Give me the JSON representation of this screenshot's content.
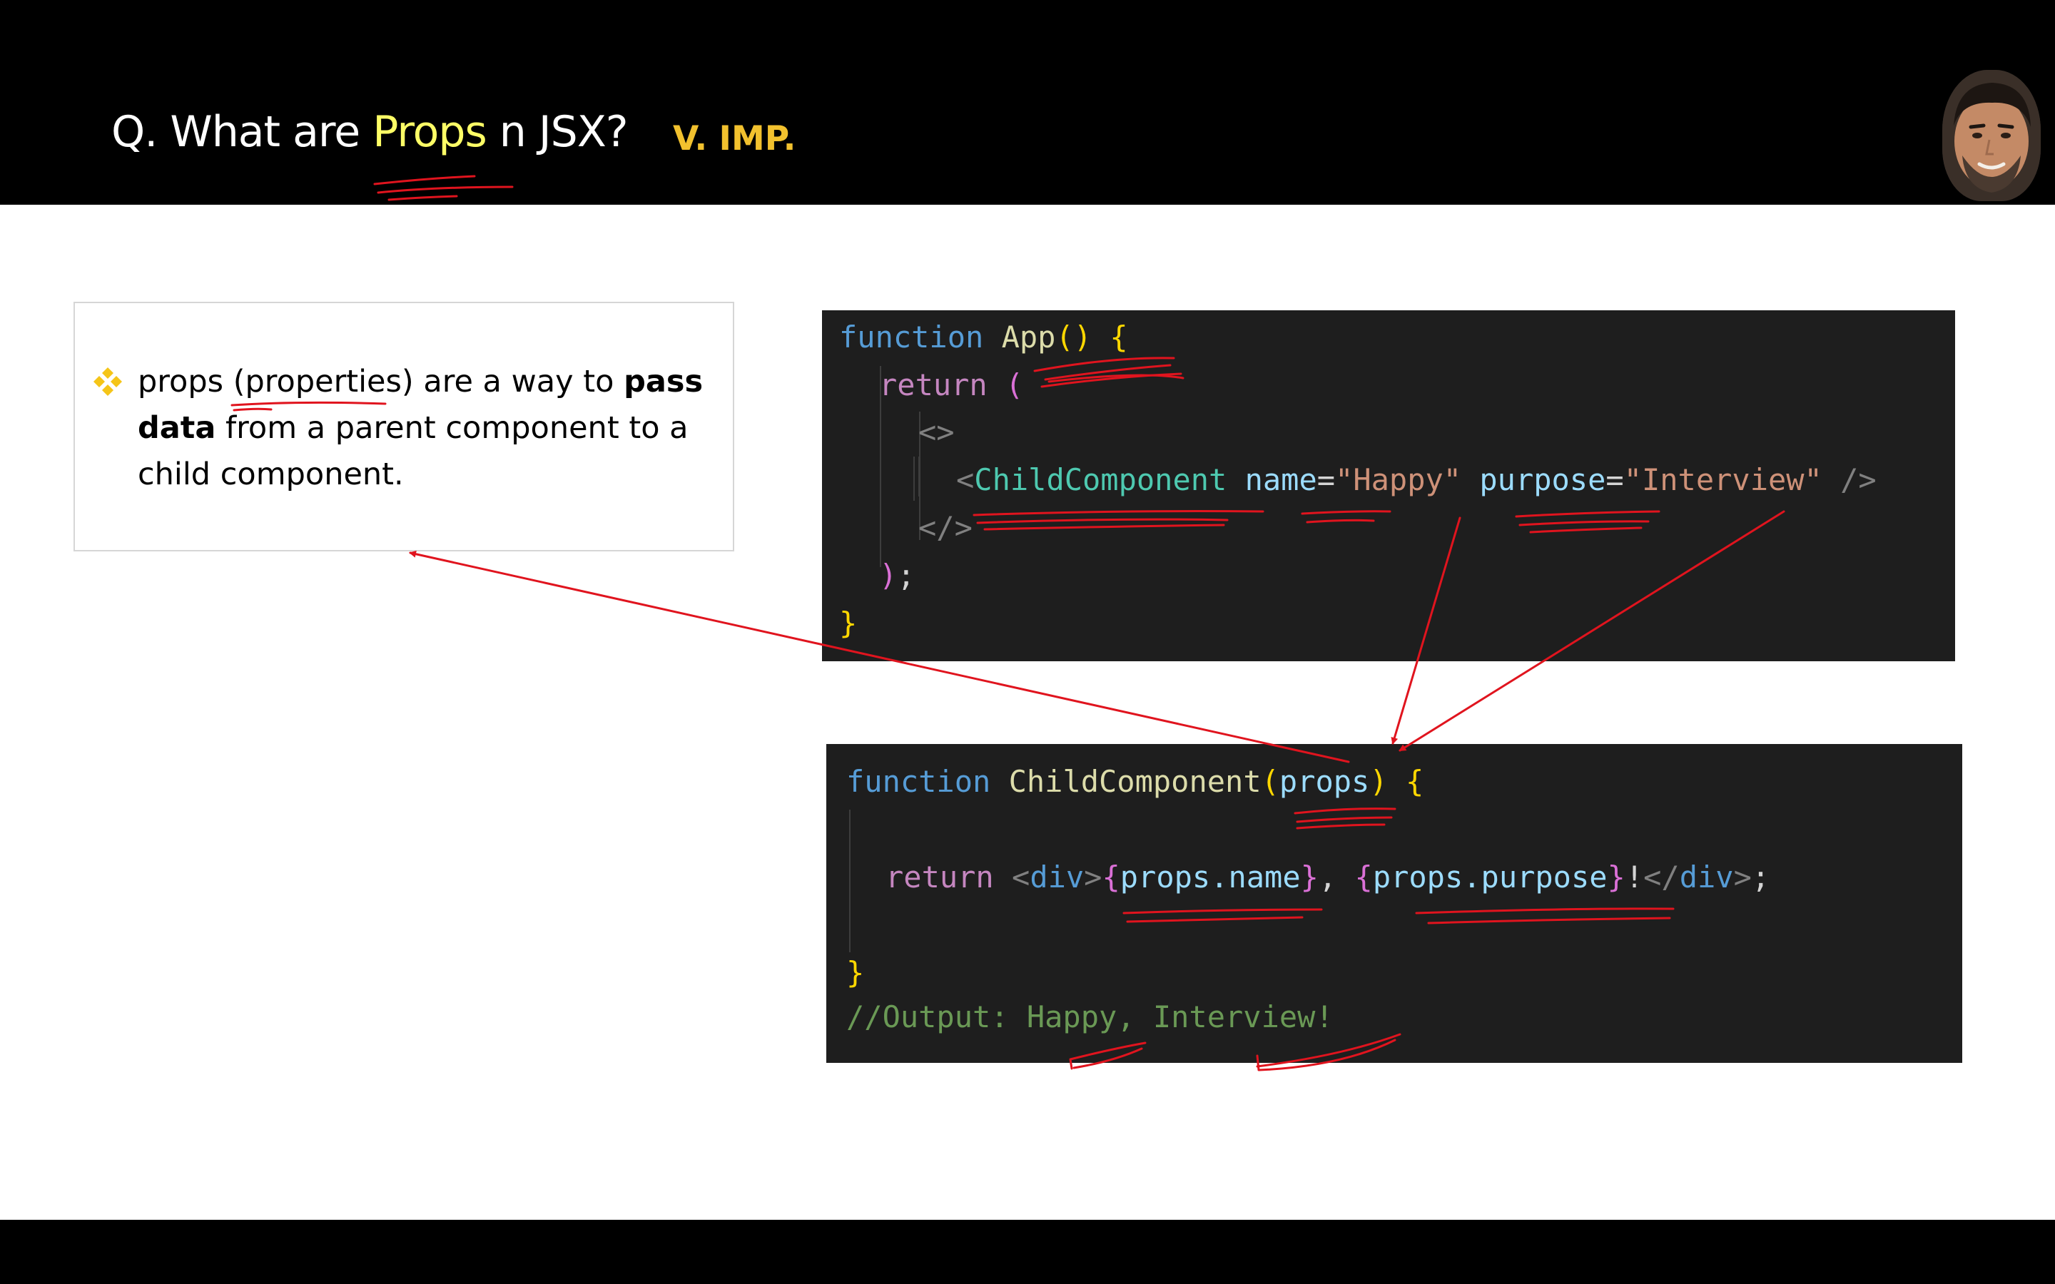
{
  "header": {
    "title_prefix": "Q. What are ",
    "title_highlight": "Props",
    "title_suffix": " n JSX?",
    "badge": "V. IMP."
  },
  "bullet": {
    "icon": "four-diamond-bullet-icon",
    "text_1": "props (properties) are a way to ",
    "bold_1": "pass data",
    "text_2": " from a parent component to a child component."
  },
  "app_code": {
    "l1_kw": "function",
    "l1_name": "App",
    "l1_parens": "()",
    "l1_brace": "{",
    "l2_kw": "return",
    "l2_paren": "(",
    "l3_frag_open": "<>",
    "l4_lt": "<",
    "l4_component": "ChildComponent",
    "l4_attr1": "name",
    "l4_eq1": "=",
    "l4_val1": "\"Happy\"",
    "l4_attr2": "purpose",
    "l4_eq2": "=",
    "l4_val2": "\"Interview\"",
    "l4_close": "/>",
    "l5_frag_close": "</>",
    "l6_paren": ")",
    "l6_semi": ";",
    "l7_brace": "}"
  },
  "child_code": {
    "l1_kw": "function",
    "l1_name": "ChildComponent",
    "l1_paren_open": "(",
    "l1_param": "props",
    "l1_paren_close": ")",
    "l1_brace": "{",
    "l2_kw": "return",
    "l2_div_open_lt": "<",
    "l2_div_open_name": "div",
    "l2_div_open_gt": ">",
    "l2_brace1_open": "{",
    "l2_expr1": "props.name",
    "l2_brace1_close": "}",
    "l2_comma": ", ",
    "l2_brace2_open": "{",
    "l2_expr2": "props.purpose",
    "l2_brace2_close": "}",
    "l2_bang": "!",
    "l2_div_close_lt": "</",
    "l2_div_close_name": "div",
    "l2_div_close_gt": ">",
    "l2_semi": ";",
    "l3_brace": "}",
    "comment": "//Output: Happy, Interview!"
  },
  "colors": {
    "slide_header_bg": "#000000",
    "title_highlight": "#ffff66",
    "badge": "#f2c12e",
    "code_bg": "#1e1e1e",
    "annotation_red": "#e0141e"
  }
}
